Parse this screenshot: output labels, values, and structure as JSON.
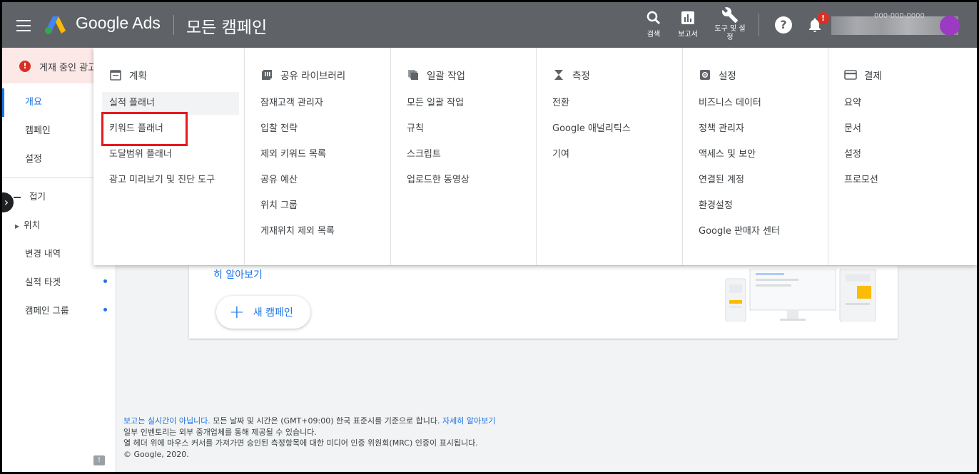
{
  "topbar": {
    "brand": "Google Ads",
    "page_title": "모든 캠페인",
    "tools": [
      {
        "label": "검색",
        "icon": "search-icon"
      },
      {
        "label": "보고서",
        "icon": "bar-chart-icon"
      },
      {
        "label": "도구 및 설정",
        "icon": "wrench-icon"
      }
    ],
    "help_icon": "help-icon",
    "notification_badge": "!",
    "account_number": "000-000-0000"
  },
  "leftnav": {
    "alert": "게재 중인 광고",
    "items": [
      {
        "label": "개요",
        "active": true
      },
      {
        "label": "캠페인",
        "active": false
      },
      {
        "label": "설정",
        "active": false
      }
    ],
    "collapse_label": "접기",
    "sub_items": [
      {
        "label": "위치",
        "expandable": true
      },
      {
        "label": "변경 내역"
      },
      {
        "label": "실적 타겟",
        "dot": true
      },
      {
        "label": "캠페인 그룹",
        "dot": true
      }
    ]
  },
  "menu": {
    "columns": [
      {
        "title": "계획",
        "icon": "calendar-icon",
        "items": [
          "실적 플래너",
          "키워드 플래너",
          "도달범위 플래너",
          "광고 미리보기 및 진단 도구"
        ]
      },
      {
        "title": "공유 라이브러리",
        "icon": "library-icon",
        "items": [
          "잠재고객 관리자",
          "입찰 전략",
          "제외 키워드 목록",
          "공유 예산",
          "위치 그룹",
          "게재위치 제외 목록"
        ]
      },
      {
        "title": "일괄 작업",
        "icon": "bulk-actions-icon",
        "items": [
          "모든 일괄 작업",
          "규칙",
          "스크립트",
          "업로드한 동영상"
        ]
      },
      {
        "title": "측정",
        "icon": "hourglass-icon",
        "items": [
          "전환",
          "Google 애널리틱스",
          "기여"
        ]
      },
      {
        "title": "설정",
        "icon": "settings-icon",
        "items": [
          "비즈니스 데이터",
          "정책 관리자",
          "액세스 및 보안",
          "연결된 계정",
          "환경설정",
          "Google 판매자 센터"
        ]
      },
      {
        "title": "결제",
        "icon": "credit-card-icon",
        "items": [
          "요약",
          "문서",
          "설정",
          "프로모션"
        ]
      }
    ]
  },
  "card": {
    "learn_more": "히 알아보기",
    "new_campaign": "새 캠페인"
  },
  "footer": {
    "line1_link": "보고는 실시간이 아닙니다.",
    "line1_text": " 모든 날짜 및 시간은 (GMT+09:00) 한국 표준시를 기준으로 합니다. ",
    "line1_link2": "자세히 알아보기",
    "line2": "일부 인벤토리는 외부 중개업체를 통해 제공될 수 있습니다.",
    "line3": "열 헤더 위에 마우스 커서를 가져가면 승인된 측정항목에 대한 미디어 인증 위원회(MRC) 인증이 표시됩니다.",
    "line4": "© Google, 2020."
  },
  "colors": {
    "topbar": "#5f6368",
    "accent": "#1a73e8",
    "highlight": "#e8171f",
    "alert": "#d93025"
  }
}
